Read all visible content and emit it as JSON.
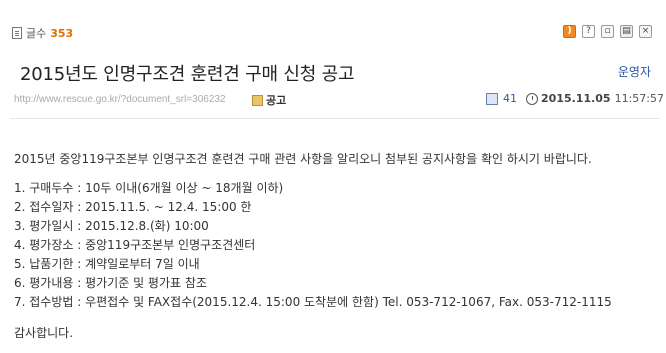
{
  "header": {
    "count_label": "글수",
    "count_value": "353",
    "tool_icons": [
      "rss-icon",
      "help-icon",
      "copy-icon",
      "print-icon",
      "close-icon"
    ]
  },
  "post": {
    "title": "2015년도 인명구조견 훈련견 구매 신청 공고",
    "author": "운영자",
    "url": "http://www.rescue.go.kr/?document_srl=306232",
    "category": "공고",
    "views": "41",
    "date": "2015.11.05",
    "time": "11:57:57"
  },
  "content": {
    "intro": "2015년 중앙119구조본부 인명구조견 훈련견 구매 관련 사항을 알리오니 첨부된 공지사항을 확인 하시기 바랍니다.",
    "items": [
      "1. 구매두수 : 10두 이내(6개월 이상 ~ 18개월 이하)",
      "2. 접수일자 : 2015.11.5. ~ 12.4. 15:00 한",
      "3. 평가일시 : 2015.12.8.(화) 10:00",
      "4. 평가장소 : 중앙119구조본부 인명구조견센터",
      "5. 납품기한 : 계약일로부터 7일 이내",
      "6. 평가내용 : 평가기준 및 평가표 참조",
      "7. 접수방법 : 우편접수 및 FAX접수(2015.12.4. 15:00 도착분에 한함) Tel. 053-712-1067, Fax. 053-712-1115"
    ],
    "thanks": "감사합니다."
  }
}
